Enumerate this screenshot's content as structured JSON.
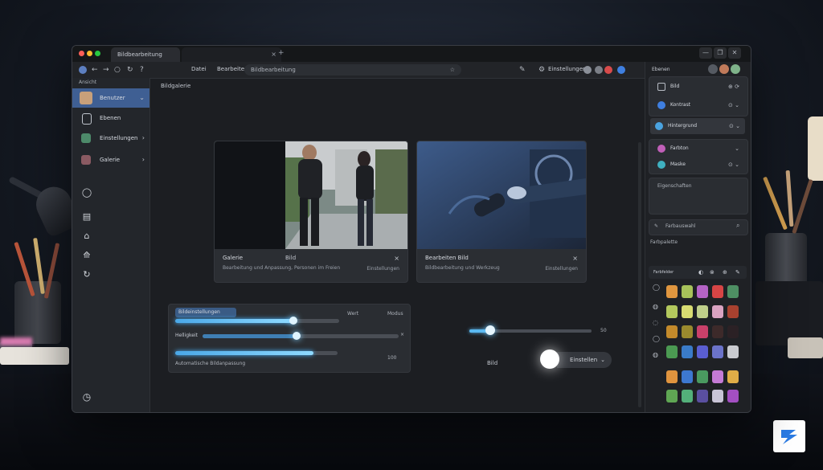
{
  "window": {
    "tab_active": "Bildbearbeitung",
    "tab_second": "",
    "close_glyph": "×",
    "new_tab_glyph": "+",
    "controls": [
      "—",
      "❐",
      "✕"
    ]
  },
  "toolbar": {
    "nav": [
      "←",
      "→",
      "○",
      "↻",
      "?"
    ],
    "menus": [
      "Datei",
      "Bearbeiten"
    ],
    "address": "Bildbearbeitung",
    "address_star": "☆",
    "right_icons": [
      "✎",
      "⚙"
    ],
    "right_text": "Einstellungen"
  },
  "sidebar": {
    "title": "Ansicht",
    "items": [
      {
        "label": "Benutzer",
        "chevron": "⌄"
      },
      {
        "label": "Ebenen",
        "chevron": ""
      },
      {
        "label": "Einstellungen",
        "chevron": "›"
      },
      {
        "label": "Galerie",
        "chevron": "›"
      }
    ],
    "tools": [
      "◯",
      "▤",
      "⌂",
      "⟰",
      "↻"
    ],
    "bottom_icon": "◷"
  },
  "main": {
    "title": "Bildgalerie",
    "cards": [
      {
        "title": "Galerie",
        "meta": "Bild",
        "close": "×",
        "desc": "Bearbeitung und Anpassung, Personen im Freien",
        "side": "Einstellungen"
      },
      {
        "title": "Bearbeiten Bild",
        "meta": "",
        "close": "×",
        "desc": "Bildbearbeitung und Werkzeug",
        "side": "Einstellungen"
      }
    ],
    "slider_panel": {
      "header": "Bildeinstellungen",
      "right_labels": [
        "Wert",
        "Modus"
      ],
      "row2_label": "Helligkeit",
      "row2_end": "×",
      "row3_value": "100",
      "footer": "Automatische Bildanpassung",
      "values": [
        0.72,
        0.48,
        0.85
      ]
    },
    "solo_slider": {
      "value": "50",
      "level": 0.18
    },
    "toggle": {
      "label": "Bild",
      "pill": "Einstellen",
      "chevron": "⌄"
    }
  },
  "right_panel": {
    "title": "Ebenen",
    "rows": [
      {
        "label": "Bild",
        "right": "⊕ ⟳"
      },
      {
        "label": "Kontrast",
        "right": "⊙ ⌄"
      },
      {
        "label": "Hintergrund",
        "right": "⊙ ⌄"
      },
      {
        "label": "Farbton",
        "right": "⌄"
      },
      {
        "label": "Maske",
        "right": "⊙ ⌄"
      }
    ],
    "notes_label": "Eigenschaften",
    "search_label": "Farbauswahl",
    "search_icon": "⌕",
    "palette_title": "Farbpalette",
    "palette_tab": "Farbfelder",
    "palette_icons": [
      "◐",
      "⊗",
      "⊕",
      "✎"
    ],
    "palette_side_icons": [
      "◯",
      "◍",
      "◌",
      "◯",
      "◍"
    ],
    "swatches": [
      [
        "#e0963f",
        "#a7c25a",
        "#b463c5",
        "#d64545",
        "#4e8f63"
      ],
      [
        "#b3c85d",
        "#d8dc72",
        "#bfcf8a",
        "#d9a3c1",
        "#a8412f"
      ],
      [
        "#c38a2b",
        "#9a8a2e",
        "#c9406a",
        "#3d2a2a",
        "#2b2125"
      ],
      [
        "#4b9a52",
        "#3a7bc8",
        "#5a5ed1",
        "#6b73c9",
        "#c9cbd0"
      ],
      [
        "#e0943e",
        "#3d78d0",
        "#4a9a60",
        "#c57bd6",
        "#e0ad47"
      ],
      [
        "#5fa653",
        "#53b07a",
        "#5a4fa0",
        "#c8c4d6",
        "#a34fc2"
      ]
    ]
  }
}
